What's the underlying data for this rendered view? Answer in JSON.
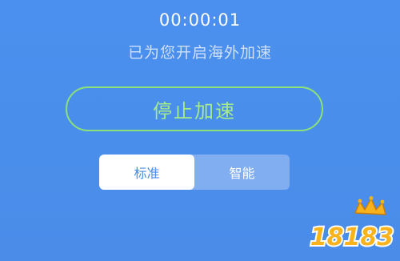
{
  "timer": "00:00:01",
  "status_text": "已为您开启海外加速",
  "stop_button_label": "停止加速",
  "mode_options": [
    "标准",
    "智能"
  ],
  "selected_mode": "标准",
  "watermark_text": "18183",
  "colors": {
    "background": "#4a8fec",
    "accent_green": "#a6ec8a",
    "active_tab_text": "#4a8ce8",
    "watermark_yellow": "#f8b21c"
  }
}
